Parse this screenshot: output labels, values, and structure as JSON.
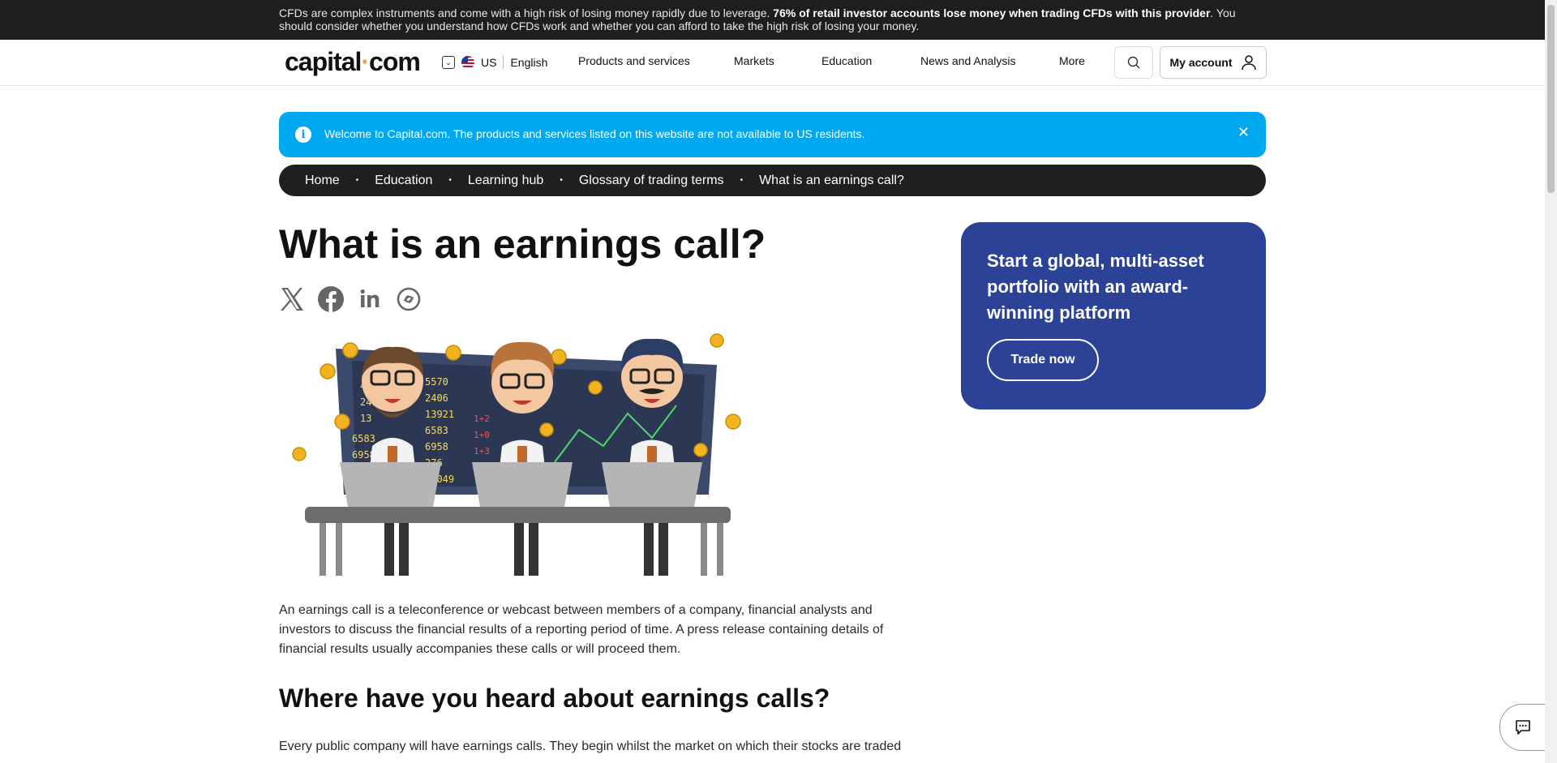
{
  "risk_warning": {
    "text_1": "CFDs are complex instruments and come with a high risk of losing money rapidly due to leverage. ",
    "bold": "76% of retail investor accounts lose money when trading CFDs with this provider",
    "text_2": ". You should consider whether you understand how CFDs work and whether you can afford to take the high risk of losing your money."
  },
  "header": {
    "logo_left": "capital",
    "logo_dot": "·",
    "logo_right": "com",
    "region": "US",
    "language": "English",
    "nav": [
      "Products and services",
      "Markets",
      "Education",
      "News and Analysis",
      "More"
    ],
    "account_label": "My account"
  },
  "notice": {
    "icon": "i",
    "message": "Welcome to Capital.com. The products and services listed on this website are not available to US residents.",
    "close": "✕"
  },
  "breadcrumbs": [
    "Home",
    "Education",
    "Learning hub",
    "Glossary of trading terms",
    "What is an earnings call?"
  ],
  "breadcrumb_separator": "•",
  "article": {
    "title": "What is an earnings call?",
    "share_icons": [
      "x-icon",
      "facebook-icon",
      "linkedin-icon",
      "copy-link-icon"
    ],
    "intro": "An earnings call is a teleconference or webcast between members of a company, financial analysts and investors to discuss the financial results of a reporting period of time. A press release containing details of financial results usually accompanies these calls or will proceed them.",
    "h2": "Where have you heard about earnings calls?",
    "para2": "Every public company will have earnings calls. They begin whilst the market on which their stocks are traded"
  },
  "promo": {
    "headline": "Start a global, multi-asset portfolio with an award-winning platform",
    "button": "Trade now"
  },
  "colors": {
    "accent_blue": "#00a8f0",
    "promo_blue": "#2c4296",
    "logo_dot": "#e6a23c"
  }
}
